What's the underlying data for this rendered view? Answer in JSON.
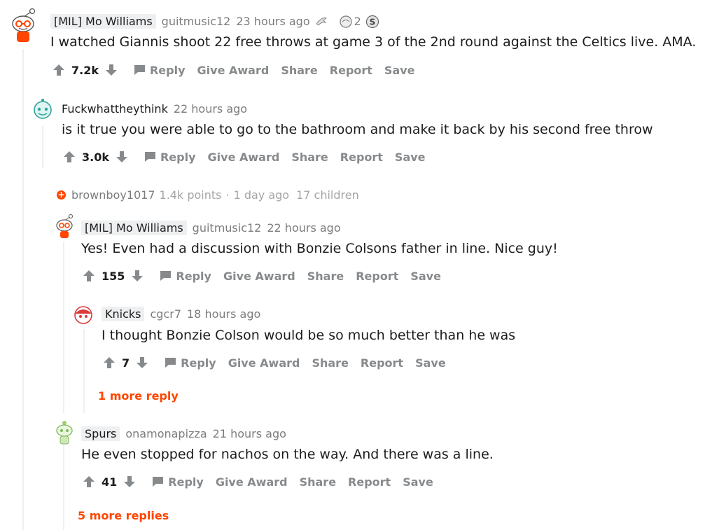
{
  "actions": {
    "reply": "Reply",
    "give_award": "Give Award",
    "share": "Share",
    "report": "Report",
    "save": "Save"
  },
  "comments": [
    {
      "flair": "[MIL] Mo Williams",
      "username": "guitmusic12",
      "time": "23 hours ago",
      "award_count": "2",
      "body": "I watched Giannis shoot 22 free throws at game 3 of the 2nd round against the Celtics live. AMA.",
      "score": "7.2k"
    },
    {
      "username": "Fuckwhattheythink",
      "time": "22 hours ago",
      "body": "is it true you were able to go to the bathroom and make it back by his second free throw",
      "score": "3.0k"
    },
    {
      "username": "brownboy1017",
      "points": "1.4k points",
      "separator": "·",
      "time": "1 day ago",
      "children": "17 children"
    },
    {
      "flair": "[MIL] Mo Williams",
      "username": "guitmusic12",
      "time": "22 hours ago",
      "body": "Yes! Even had a discussion with Bonzie Colsons father in line. Nice guy!",
      "score": "155"
    },
    {
      "flair": "Knicks",
      "username": "cgcr7",
      "time": "18 hours ago",
      "body": "I thought Bonzie Colson would be so much better than he was",
      "score": "7",
      "more": "1 more reply"
    },
    {
      "flair": "Spurs",
      "username": "onamonapizza",
      "time": "21 hours ago",
      "body": "He even stopped for nachos on the way. And there was a line.",
      "score": "41",
      "more": "5 more replies"
    }
  ],
  "colors": {
    "accent": "#ff4500",
    "muted": "#878a8c",
    "thread": "#edeff1"
  }
}
